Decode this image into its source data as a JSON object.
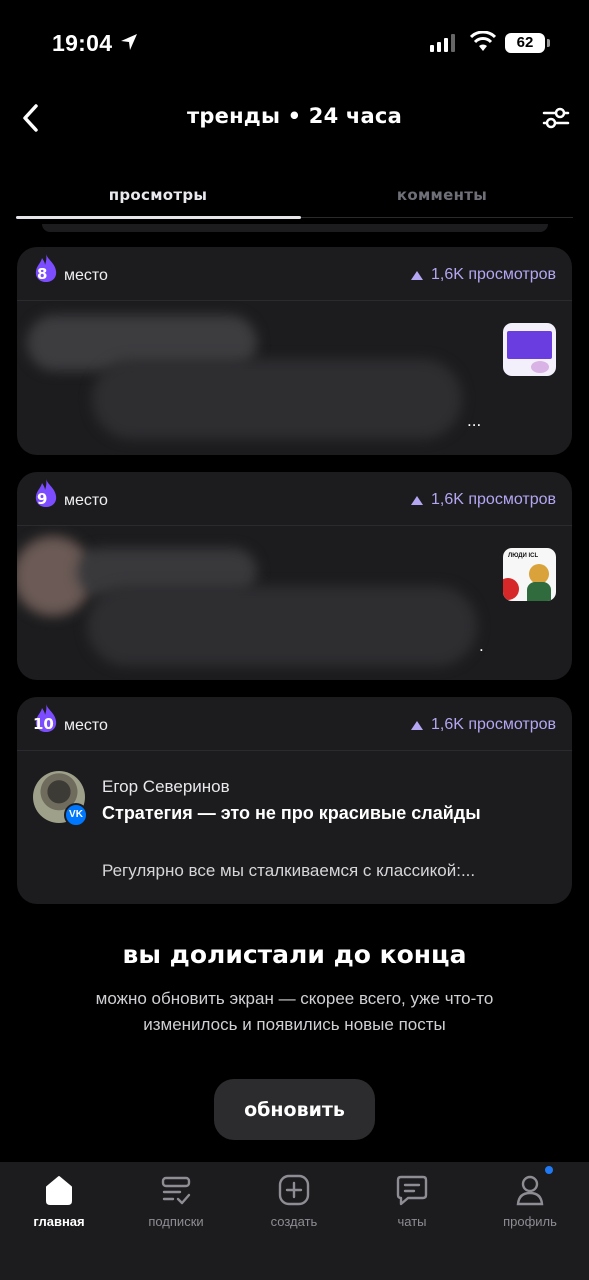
{
  "status_bar": {
    "time": "19:04",
    "battery": "62"
  },
  "header": {
    "title": "тренды • 24 часа"
  },
  "tabs": [
    {
      "label": "просмотры",
      "active": true
    },
    {
      "label": "комменты",
      "active": false
    }
  ],
  "cards": [
    {
      "rank": "8",
      "rank_label": "место",
      "views": "1,6K просмотров",
      "excerpt_tail": "..."
    },
    {
      "rank": "9",
      "rank_label": "место",
      "views": "1,6K просмотров",
      "excerpt_tail": "."
    },
    {
      "rank": "10",
      "rank_label": "место",
      "views": "1,6K просмотров",
      "author": "Егор Северинов",
      "title": "Стратегия — это не про красивые слайды",
      "excerpt": "Регулярно все мы сталкиваемся с классикой:...",
      "badge": "VK"
    }
  ],
  "thumb_text": {
    "card9": "ЛЮДИ ICL"
  },
  "end": {
    "title": "вы долистали до конца",
    "description": "можно обновить экран — скорее всего, уже что-то изменилось и появились новые посты",
    "button": "обновить"
  },
  "nav": [
    {
      "label": "главная",
      "icon": "home-icon",
      "active": true
    },
    {
      "label": "подписки",
      "icon": "subscriptions-icon",
      "active": false
    },
    {
      "label": "создать",
      "icon": "create-icon",
      "active": false
    },
    {
      "label": "чаты",
      "icon": "chat-icon",
      "active": false
    },
    {
      "label": "профиль",
      "icon": "profile-icon",
      "active": false
    }
  ],
  "colors": {
    "accent": "#b4a6f3",
    "flame": "#7c4dff",
    "card_bg": "#1c1c1e",
    "badge_dot": "#1f7af4"
  }
}
